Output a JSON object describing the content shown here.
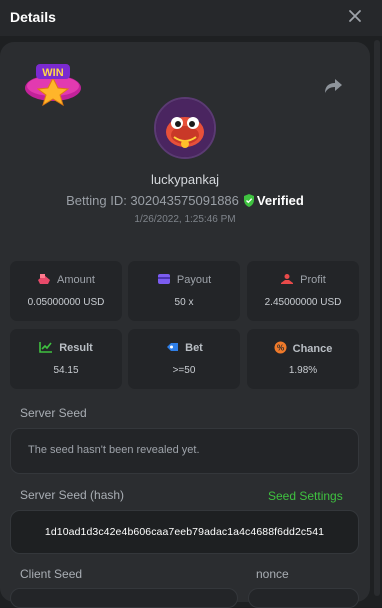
{
  "header": {
    "title": "Details",
    "close_icon": "close-icon"
  },
  "profile": {
    "badge_text": "WIN",
    "username": "luckypankaj",
    "betting_id_label": "Betting ID: 302043575091886",
    "verified_label": "Verified",
    "date": "1/26/2022, 1:25:46 PM"
  },
  "stats": {
    "amount": {
      "label": "Amount",
      "value": "0.05000000 USD",
      "icon": "amount-icon",
      "color": "#e84a6a"
    },
    "payout": {
      "label": "Payout",
      "value": "50 x",
      "icon": "payout-icon",
      "color": "#7b5cf0"
    },
    "profit": {
      "label": "Profit",
      "value": "2.45000000 USD",
      "icon": "profit-icon",
      "color": "#e84a4a"
    },
    "result": {
      "label": "Result",
      "value": "54.15",
      "icon": "result-icon",
      "color": "#3fc240"
    },
    "bet": {
      "label": "Bet",
      "value": ">=50",
      "icon": "bet-icon",
      "color": "#2f7fe8"
    },
    "chance": {
      "label": "Chance",
      "value": "1.98%",
      "icon": "chance-icon",
      "color": "#f07a2a"
    }
  },
  "seeds": {
    "server_seed_label": "Server Seed",
    "server_seed_value": "The seed hasn't been revealed yet.",
    "server_hash_label": "Server Seed (hash)",
    "seed_settings_link": "Seed Settings",
    "server_hash_value": "1d10ad1d3c42e4b606caa7eeb79adac1a4c4688f6dd2c541",
    "client_seed_label": "Client Seed",
    "nonce_label": "nonce"
  },
  "colors": {
    "accent_green": "#3fc240",
    "background": "#1e2022",
    "panel": "#2b2d30"
  }
}
